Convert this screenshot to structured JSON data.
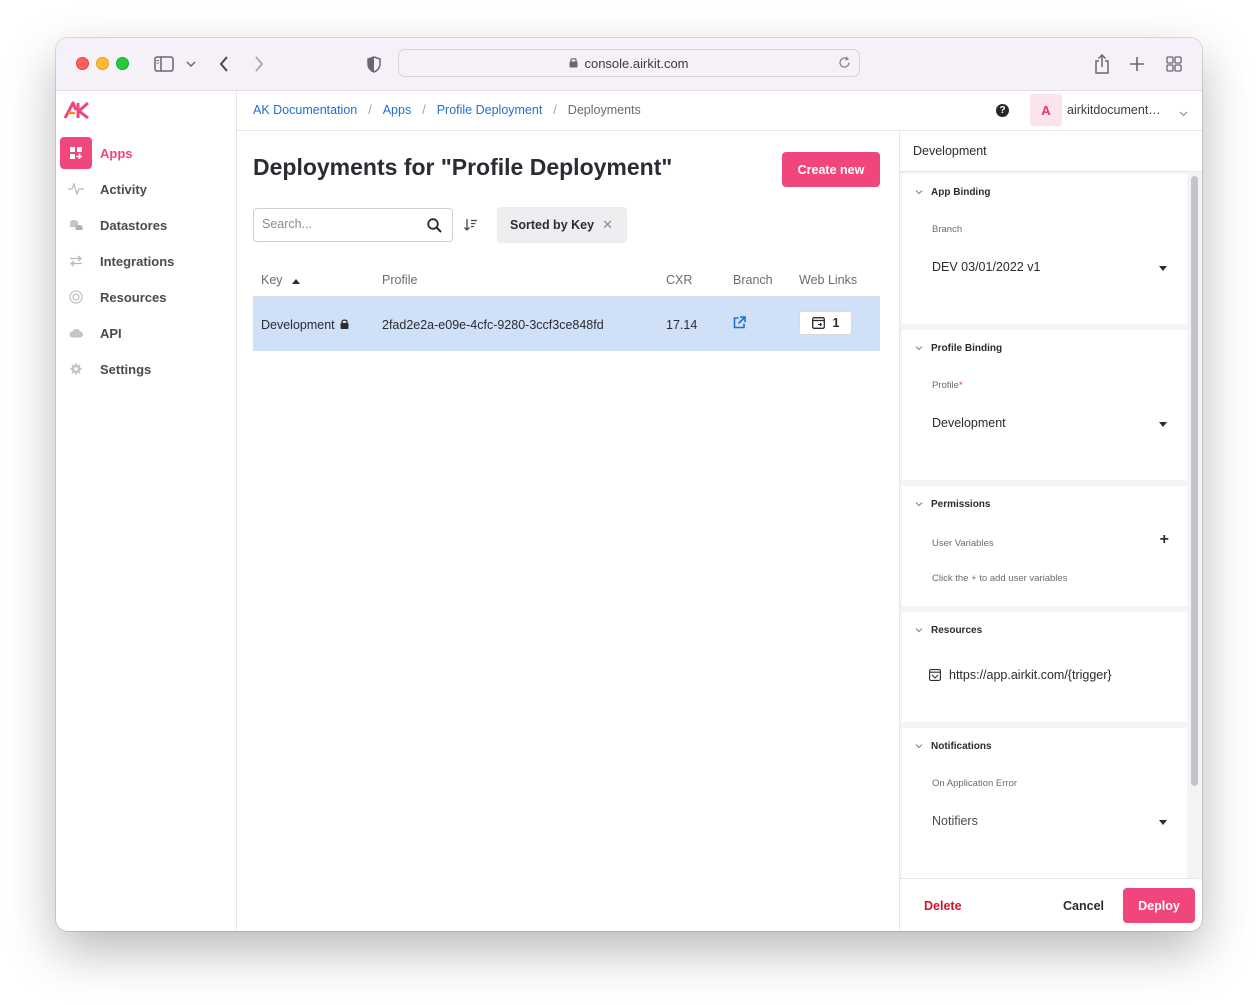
{
  "browser": {
    "url": "console.airkit.com"
  },
  "sidebar": {
    "logo": "AK",
    "items": [
      {
        "label": "Apps",
        "icon": "apps-icon",
        "active": true
      },
      {
        "label": "Activity",
        "icon": "activity-icon"
      },
      {
        "label": "Datastores",
        "icon": "datastores-icon"
      },
      {
        "label": "Integrations",
        "icon": "integrations-icon"
      },
      {
        "label": "Resources",
        "icon": "resources-icon"
      },
      {
        "label": "API",
        "icon": "api-icon"
      },
      {
        "label": "Settings",
        "icon": "settings-icon"
      }
    ]
  },
  "header": {
    "breadcrumbs": [
      "AK Documentation",
      "Apps",
      "Profile Deployment",
      "Deployments"
    ],
    "help": "?",
    "avatar_initial": "A",
    "org_name": "airkitdocumentation"
  },
  "main": {
    "title": "Deployments for \"Profile Deployment\"",
    "create_button": "Create new",
    "search_placeholder": "Search...",
    "sort_chip": "Sorted by Key",
    "sort_chip_close": "✕",
    "columns": [
      "Key",
      "Profile",
      "CXR",
      "Branch",
      "Web Links"
    ],
    "rows": [
      {
        "key": "Development",
        "profile": "2fad2e2a-e09e-4cfc-9280-3ccf3ce848fd",
        "cxr": "17.14",
        "web_links": "1"
      }
    ]
  },
  "panel": {
    "title": "Development",
    "app_binding": {
      "title": "App Binding",
      "branch_label": "Branch",
      "branch_value": "DEV 03/01/2022 v1"
    },
    "profile_binding": {
      "title": "Profile Binding",
      "profile_label": "Profile",
      "required_mark": "*",
      "profile_value": "Development"
    },
    "permissions": {
      "title": "Permissions",
      "user_variables_label": "User Variables",
      "add_symbol": "+",
      "hint": "Click the + to add user variables"
    },
    "resources": {
      "title": "Resources",
      "url": "https://app.airkit.com/{trigger}"
    },
    "notifications": {
      "title": "Notifications",
      "error_label": "On Application Error",
      "notifiers_value": "Notifiers"
    },
    "footer": {
      "delete": "Delete",
      "cancel": "Cancel",
      "deploy": "Deploy"
    }
  },
  "colors": {
    "brand": "#f0467c",
    "link": "#1f6fd1",
    "selected_row": "#cfe0f7",
    "danger": "#d0152c"
  }
}
